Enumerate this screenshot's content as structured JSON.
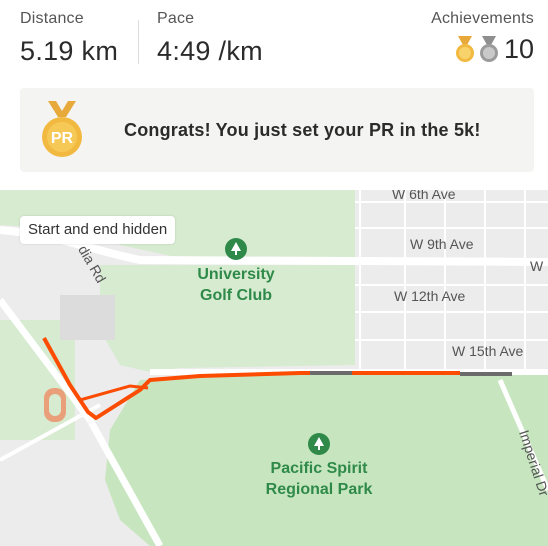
{
  "stats": {
    "distance": {
      "label": "Distance",
      "value": "5.19 km"
    },
    "pace": {
      "label": "Pace",
      "value": "4:49 /km"
    },
    "achievements": {
      "label": "Achievements",
      "count": "10",
      "medals": [
        "gold-medal-icon",
        "silver-medal-icon"
      ]
    }
  },
  "banner": {
    "badge_text": "PR",
    "message": "Congrats! You just set your PR in the 5k!"
  },
  "map": {
    "privacy_chip": "Start and end hidden",
    "streets": {
      "w6": "W 6th Ave",
      "w9": "W 9th Ave",
      "w_edge": "W",
      "w12": "W 12th Ave",
      "w15": "W 15th Ave",
      "imperial": "Imperial Dr",
      "dia": "dia Rd"
    },
    "places": {
      "golf_line1": "University",
      "golf_line2": "Golf Club",
      "park_line1": "Pacific Spirit",
      "park_line2": "Regional Park"
    },
    "colors": {
      "route": "#fc4c02",
      "park": "#c7e6bf",
      "hidden_segment": "#6b6b6b"
    }
  }
}
